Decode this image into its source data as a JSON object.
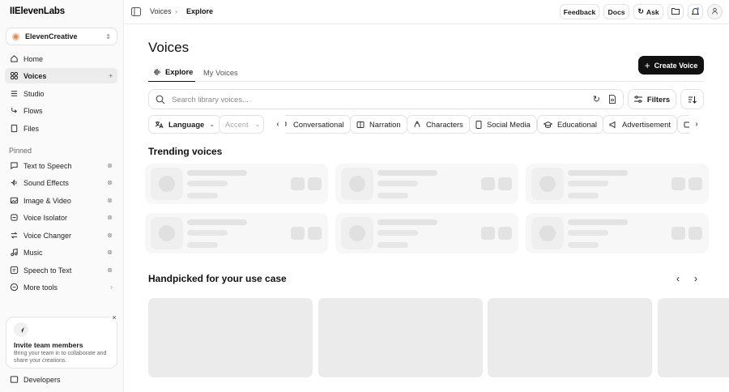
{
  "brand": {
    "logo_text": "IIElevenLabs"
  },
  "workspace": {
    "name": "ElevenCreative"
  },
  "sidebar": {
    "main_items": [
      {
        "label": "Home",
        "icon": "home-icon"
      },
      {
        "label": "Voices",
        "icon": "voices-icon",
        "active": true,
        "trail": "+"
      },
      {
        "label": "Studio",
        "icon": "studio-icon"
      },
      {
        "label": "Flows",
        "icon": "flows-icon"
      },
      {
        "label": "Files",
        "icon": "files-icon"
      }
    ],
    "pinned_label": "Pinned",
    "pinned_items": [
      {
        "label": "Text to Speech",
        "icon": "text-to-speech-icon"
      },
      {
        "label": "Sound Effects",
        "icon": "sound-effects-icon"
      },
      {
        "label": "Image & Video",
        "icon": "image-video-icon"
      },
      {
        "label": "Voice Isolator",
        "icon": "voice-isolator-icon"
      },
      {
        "label": "Voice Changer",
        "icon": "voice-changer-icon"
      },
      {
        "label": "Music",
        "icon": "music-icon"
      },
      {
        "label": "Speech to Text",
        "icon": "speech-to-text-icon"
      },
      {
        "label": "More tools",
        "icon": "more-tools-icon"
      }
    ],
    "invite": {
      "title": "Invite team members",
      "description": "Bring your team in to collaborate and share your creations."
    },
    "developers_label": "Developers"
  },
  "topbar": {
    "breadcrumb": [
      "Voices",
      "Explore"
    ],
    "feedback_label": "Feedback",
    "docs_label": "Docs",
    "ask_label": "Ask"
  },
  "main": {
    "title": "Voices",
    "create_button": "Create Voice",
    "tabs": [
      {
        "label": "Explore",
        "active": true
      },
      {
        "label": "My Voices",
        "active": false
      }
    ],
    "search": {
      "placeholder": "Search library voices..."
    },
    "filters_label": "Filters",
    "language_label": "Language",
    "accent_label": "Accent",
    "categories": [
      {
        "label": "Conversational",
        "icon": "conversational-icon"
      },
      {
        "label": "Narration",
        "icon": "narration-icon"
      },
      {
        "label": "Characters",
        "icon": "characters-icon"
      },
      {
        "label": "Social Media",
        "icon": "social-media-icon"
      },
      {
        "label": "Educational",
        "icon": "educational-icon"
      },
      {
        "label": "Advertisement",
        "icon": "advertisement-icon"
      }
    ],
    "trending_title": "Trending voices",
    "handpicked_title": "Handpicked for your use case"
  },
  "colors": {
    "accent": "#111111",
    "sidebar_bg": "#fafafa",
    "skeleton": "#ebebeb"
  }
}
